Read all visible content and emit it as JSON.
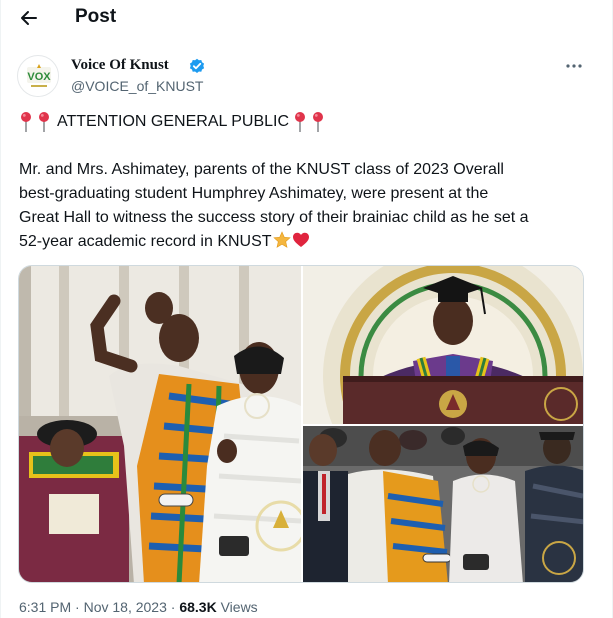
{
  "header": {
    "title": "Post",
    "back_icon": "arrow-left-icon"
  },
  "author": {
    "name": "Voice Of Knust",
    "handle": "@VOICE_of_KNUST",
    "avatar_text": "VOX",
    "verified": true,
    "verified_color": "#1d9bf0",
    "avatar_icon": "vox-logo-icon"
  },
  "post": {
    "attention_line": "ATTENTION GENERAL PUBLIC",
    "body_lines": [
      "Mr. and Mrs. Ashimatey, parents of the KNUST class of 2023 Overall",
      "best-graduating student Humphrey Ashimatey, were present at the",
      "Great Hall to witness the success story of their brainiac child as he set a",
      "52-year academic record in KNUST"
    ],
    "emojis": [
      "pushpin-icon",
      "star-icon",
      "red-heart-icon"
    ],
    "images": [
      "parents-waving-photo",
      "graduate-speaking-at-podium-photo",
      "parents-seated-in-hall-photo"
    ]
  },
  "meta": {
    "time": "6:31 PM",
    "date": "Nov 18, 2023",
    "views_count": "68.3K",
    "views_label": "Views",
    "separator": "·"
  },
  "colors": {
    "text": "#0f1419",
    "secondary": "#536471",
    "border": "#cfd9de",
    "accent": "#1d9bf0"
  }
}
